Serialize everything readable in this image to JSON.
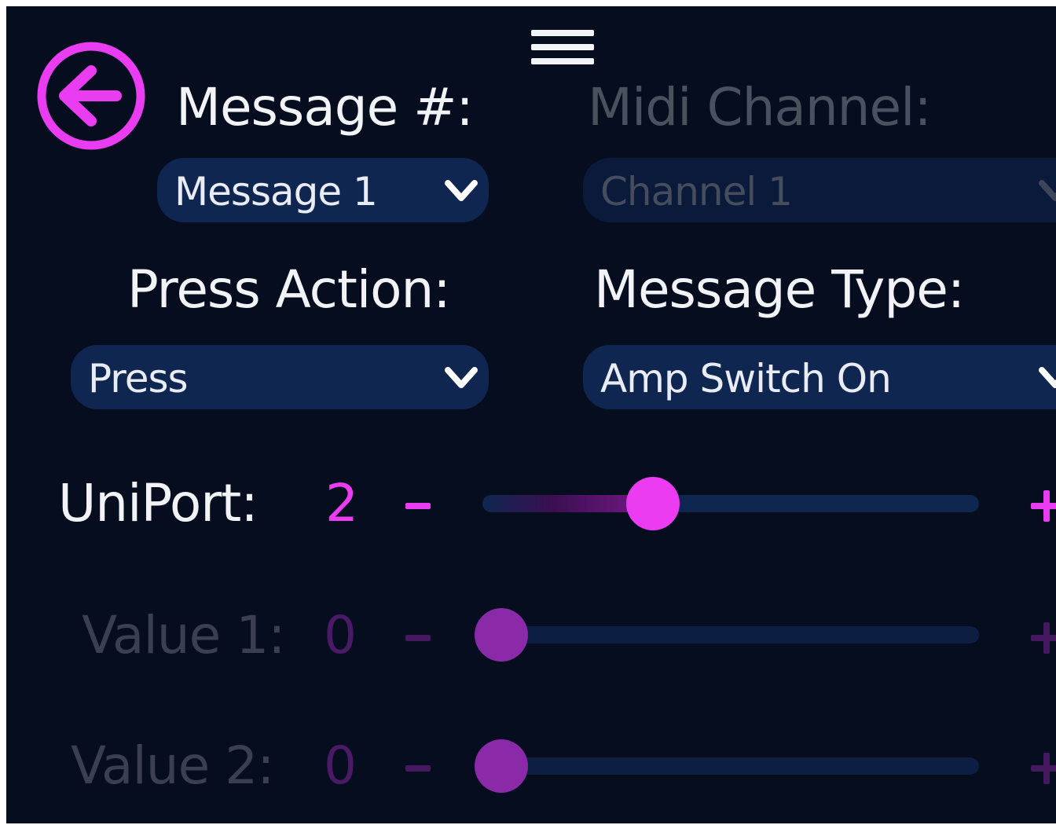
{
  "colors": {
    "accent": "#ea3cf0",
    "background": "#050d1f",
    "field": "#0f2650"
  },
  "header": {
    "menu_icon": "hamburger-menu-icon",
    "back_icon": "back-arrow-circle-icon"
  },
  "message": {
    "label": "Message #:",
    "value": "Message 1"
  },
  "midi_channel": {
    "label": "Midi Channel:",
    "value": "Channel 1"
  },
  "press_action": {
    "label": "Press Action:",
    "value": "Press"
  },
  "message_type": {
    "label": "Message Type:",
    "value": "Amp Switch On"
  },
  "sliders": [
    {
      "label": "UniPort:",
      "value": "2",
      "minus": "-",
      "fraction": 0.33,
      "enabled": true
    },
    {
      "label": "Value 1:",
      "value": "0",
      "minus": "-",
      "fraction": 0.0,
      "enabled": false
    },
    {
      "label": "Value 2:",
      "value": "0",
      "minus": "-",
      "fraction": 0.0,
      "enabled": false
    }
  ]
}
